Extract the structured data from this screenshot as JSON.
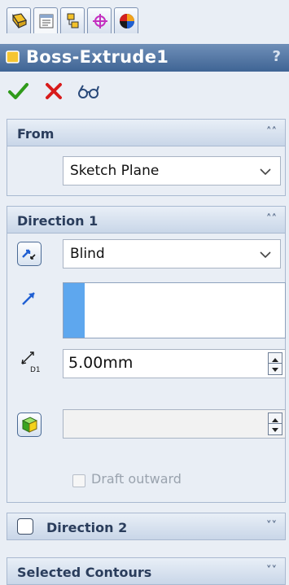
{
  "tabs": [
    {
      "name": "featuremanager-tab",
      "icon": "feature-tree-icon"
    },
    {
      "name": "propertymanager-tab",
      "icon": "property-sheet-icon",
      "active": true
    },
    {
      "name": "configurationmanager-tab",
      "icon": "configuration-icon"
    },
    {
      "name": "dimxpert-tab",
      "icon": "crosshair-icon"
    },
    {
      "name": "display-manager-tab",
      "icon": "color-wheel-icon"
    }
  ],
  "header": {
    "title": "Boss-Extrude1",
    "help": "?"
  },
  "actions": [
    "ok-check-icon",
    "cancel-x-icon",
    "preview-glasses-icon"
  ],
  "from": {
    "label": "From",
    "value": "Sketch Plane"
  },
  "direction1": {
    "label": "Direction 1",
    "end_condition": "Blind",
    "depth": "5.00mm",
    "depth_icon_label": "D1",
    "draft_value": "",
    "draft_outward_label": "Draft outward"
  },
  "direction2": {
    "label": "Direction 2",
    "checked": false
  },
  "selected_contours": {
    "label": "Selected Contours"
  },
  "colors": {
    "header_gradient_top": "#6f8fb8",
    "header_gradient_bottom": "#3f6494",
    "accent_blue": "#5ea7ee",
    "ok_green": "#2f9a1a",
    "cancel_red": "#d81b1b"
  }
}
